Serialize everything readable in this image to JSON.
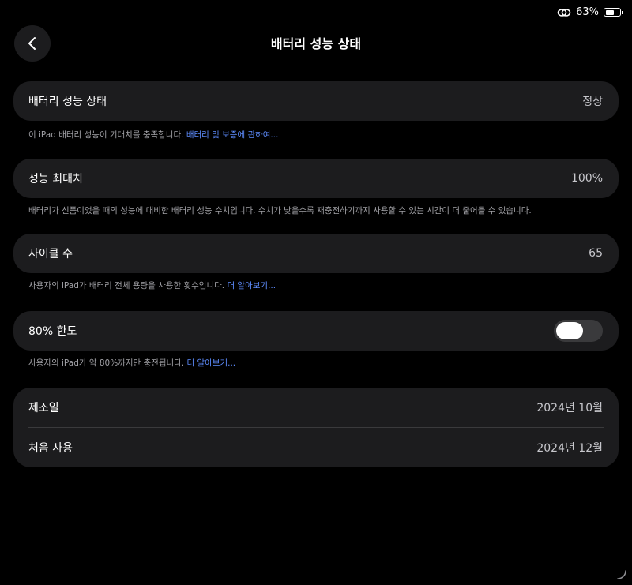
{
  "status": {
    "battery_percent": "63%",
    "battery_level": 0.63
  },
  "header": {
    "title": "배터리 성능 상태"
  },
  "health": {
    "label": "배터리 성능 상태",
    "value": "정상"
  },
  "health_note": {
    "text": "이 iPad 배터리 성능이 기대치를 충족합니다. ",
    "link": "배터리 및 보증에 관하여..."
  },
  "max_capacity": {
    "label": "성능 최대치",
    "value": "100%"
  },
  "max_capacity_note": {
    "text": "배터리가 신품이었을 때의 성능에 대비한 배터리 성능 수치입니다. 수치가 낮을수록 재충전하기까지 사용할 수 있는 시간이 더 줄어들 수 있습니다."
  },
  "cycle": {
    "label": "사이클 수",
    "value": "65"
  },
  "cycle_note": {
    "text": "사용자의 iPad가 배터리 전체 용량을 사용한 횟수입니다. ",
    "link": "더 알아보기..."
  },
  "limit": {
    "label": "80% 한도",
    "enabled": false
  },
  "limit_note": {
    "text": "사용자의 iPad가 약 80%까지만 충전됩니다. ",
    "link": "더 알아보기..."
  },
  "dates": {
    "manufacture_label": "제조일",
    "manufacture_value": "2024년 10월",
    "first_use_label": "처음 사용",
    "first_use_value": "2024년 12월"
  }
}
